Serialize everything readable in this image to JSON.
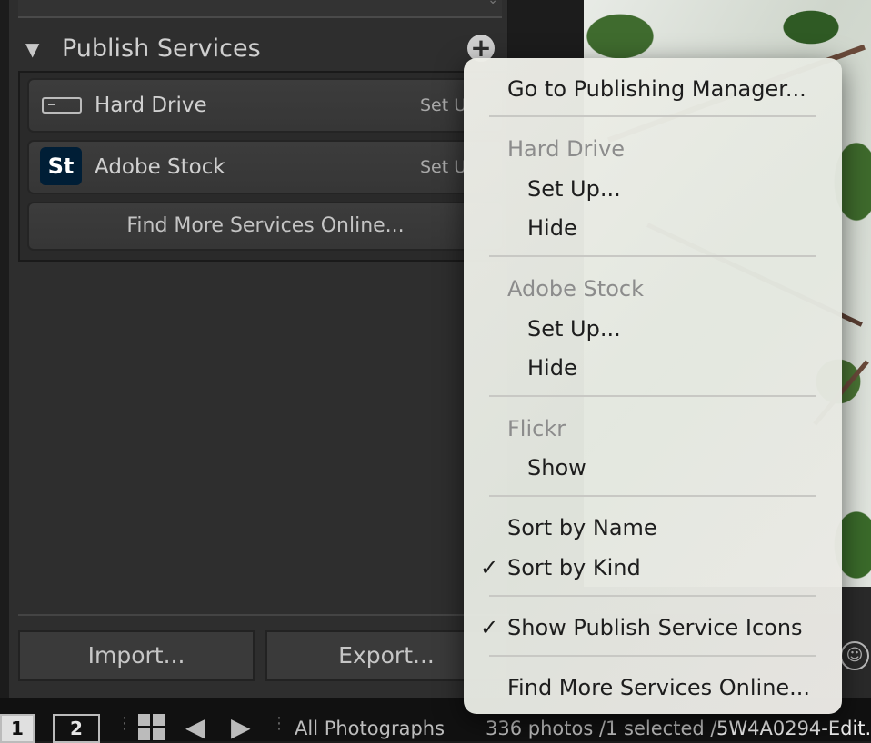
{
  "panel": {
    "title": "Publish Services",
    "collapse_glyph": "▼",
    "add_glyph": "+",
    "services": [
      {
        "name": "Hard Drive",
        "action": "Set U"
      },
      {
        "name": "Adobe Stock",
        "action": "Set U",
        "icon_text": "St"
      }
    ],
    "find_more": "Find More Services Online..."
  },
  "bottom_buttons": {
    "import": "Import...",
    "export": "Export..."
  },
  "filmstrip": {
    "screen1": "1",
    "screen2": "2",
    "source": "All Photographs",
    "count": "336 photos /1 selected /",
    "filename": "5W4A0294-Edit."
  },
  "menu": {
    "go_to_manager": "Go to Publishing Manager...",
    "hard_drive_header": "Hard Drive",
    "hard_drive_setup": "Set Up...",
    "hard_drive_hide": "Hide",
    "adobe_stock_header": "Adobe Stock",
    "adobe_stock_setup": "Set Up...",
    "adobe_stock_hide": "Hide",
    "flickr_header": "Flickr",
    "flickr_show": "Show",
    "sort_by_name": "Sort by Name",
    "sort_by_kind": "Sort by Kind",
    "show_icons": "Show Publish Service Icons",
    "find_more": "Find More Services Online...",
    "check_glyph": "✓"
  },
  "colors": {
    "adobe_stock_icon_bg": "#001e36",
    "panel_bg": "#2e2e2e"
  }
}
